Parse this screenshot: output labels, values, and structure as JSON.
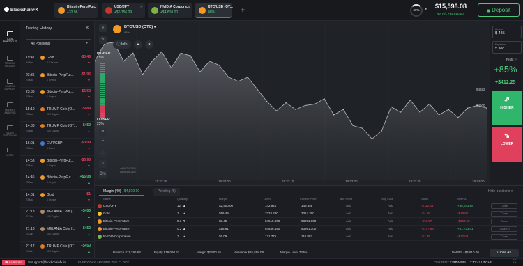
{
  "app": {
    "logo": "BlockchainFX"
  },
  "tabs": [
    {
      "name": "Bitcoin-Perp/Fu...",
      "pct": "+32.98",
      "color": "#f29a26"
    },
    {
      "name": "USD/JPY",
      "pct": "+$6,156.29",
      "color": "#c0392b"
    },
    {
      "name": "NVIDIA Corpora...",
      "pct": "+$4,810.00",
      "color": "#7cb342"
    },
    {
      "name": "BTC/USD (OT...",
      "pct": "88%",
      "color": "#f29a26"
    }
  ],
  "account": {
    "circle": "60%",
    "balance": "$15,598.08",
    "net_pl": "Net P/L +$4,610.00",
    "deposit_label": "Deposit"
  },
  "sidebar": [
    {
      "label": "TOTAL PORTFOLIO"
    },
    {
      "label": "TRADING HISTORY"
    },
    {
      "label": "CHATS & SUPPORT"
    },
    {
      "label": "MARKET ANALYSIS"
    },
    {
      "label": "VIDEO TUTORIALS"
    },
    {
      "label": "MORE"
    }
  ],
  "history": {
    "title": "Trading History",
    "close": "✕",
    "filter": "All Positions",
    "rows": [
      {
        "time": "19:41",
        "date": "24 Mar",
        "name": "Gold",
        "amount": "0.1 Ounce",
        "value": "-$0.46",
        "dir": "▼",
        "neg": true,
        "color": "#f29a26"
      },
      {
        "time": "23:36",
        "date": "23 Mar",
        "name": "Bitcoin-PerpFut...",
        "amount": "1 Crypto",
        "value": "-$1.96",
        "dir": "▼",
        "neg": true,
        "color": "#f29a26"
      },
      {
        "time": "23:36",
        "date": "23 Mar",
        "name": "Bitcoin-PerpFut...",
        "amount": "1 Crypto",
        "value": "-$6.52",
        "dir": "▼",
        "neg": true,
        "color": "#f29a26"
      },
      {
        "time": "15:10",
        "date": "23 Mar",
        "name": "TRUMP Coin (O...",
        "amount": "100 Crypto",
        "value": "-$489",
        "dir": "▼",
        "neg": true,
        "color": "#e07b2a"
      },
      {
        "time": "14:38",
        "date": "23 Mar",
        "name": "TRUMP Coin (OT...",
        "amount": "100 Crypto",
        "value": "+$450",
        "dir": "▲",
        "neg": false,
        "color": "#e07b2a"
      },
      {
        "time": "16:01",
        "date": "23 Mar",
        "name": "EUR/GBP",
        "amount": "1 Forex",
        "value": "-$0.09",
        "dir": "▼",
        "neg": true,
        "color": "#3a7bd5"
      },
      {
        "time": "14:53",
        "date": "23 Mar",
        "name": "Bitcoin-PerpFut...",
        "amount": "1 Crypto",
        "value": "-$5.93",
        "dir": "▼",
        "neg": true,
        "color": "#f29a26"
      },
      {
        "time": "14:45",
        "date": "23 Mar",
        "name": "Bitcoin-PerpFut...",
        "amount": "1 Crypto",
        "value": "+$5.08",
        "dir": "▲",
        "neg": false,
        "color": "#f29a26"
      },
      {
        "time": "14:01",
        "date": "23 Mar",
        "name": "Gold",
        "amount": "1 Ounce",
        "value": "-$1",
        "dir": "▼",
        "neg": true,
        "color": "#f29a26"
      },
      {
        "time": "21:18",
        "date": "21 Jan",
        "name": "MELANIA Coin (...",
        "amount": "100 Crypto",
        "value": "+$450",
        "dir": "▲",
        "neg": false,
        "color": "#b08968"
      },
      {
        "time": "21:18",
        "date": "21 Jan",
        "name": "MELANIA Coin (...",
        "amount": "100 Crypto",
        "value": "+$450",
        "dir": "▲",
        "neg": false,
        "color": "#b08968"
      },
      {
        "time": "21:17",
        "date": "21 Jan",
        "name": "TRUMP Coin (OT...",
        "amount": "100 Crypto",
        "value": "+$450",
        "dir": "▲",
        "neg": false,
        "color": "#e07b2a"
      }
    ]
  },
  "chart": {
    "asset": "BTC/USD (OTC)",
    "asset_sub": "88%",
    "info": "Info",
    "higher": "HIGHER",
    "higher_pct": "75%",
    "lower": "LOWER",
    "lower_pct": "25%",
    "price_right": [
      "94682",
      "94600"
    ],
    "x_times": [
      "19:32:45",
      "19:33:00",
      "19:33:15",
      "19:33:30",
      "19:33:45",
      "19:34:00"
    ],
    "bottom_left": [
      "vol 94,718.2500",
      "vol 94,598.2500"
    ]
  },
  "chart_data": {
    "type": "area",
    "x": [
      "19:32:38",
      "19:32:40",
      "19:32:42",
      "19:32:44",
      "19:32:46",
      "19:32:48",
      "19:32:50",
      "19:32:52",
      "19:32:54",
      "19:32:56",
      "19:32:58",
      "19:33:00",
      "19:33:02",
      "19:33:04",
      "19:33:06",
      "19:33:08",
      "19:33:10",
      "19:33:12",
      "19:33:14",
      "19:33:16",
      "19:33:18",
      "19:33:20",
      "19:33:22",
      "19:33:24",
      "19:33:26",
      "19:33:28",
      "19:33:30",
      "19:33:32",
      "19:33:34",
      "19:33:36",
      "19:33:38",
      "19:33:40",
      "19:33:42",
      "19:33:44",
      "19:33:46",
      "19:33:48",
      "19:33:50",
      "19:33:52",
      "19:33:54",
      "19:33:56",
      "19:33:58",
      "19:34:00"
    ],
    "values": [
      94700,
      94713,
      94714,
      94700,
      94706,
      94690,
      94700,
      94707,
      94695,
      94706,
      94704,
      94692,
      94700,
      94697,
      94688,
      94685,
      94688,
      94679,
      94670,
      94663,
      94669,
      94664,
      94667,
      94668,
      94672,
      94660,
      94664,
      94652,
      94650,
      94642,
      94648,
      94666,
      94662,
      94671,
      94662,
      94668,
      94660,
      94664,
      94658,
      94665,
      94667,
      94665
    ],
    "ylim": [
      94620,
      94730
    ]
  },
  "right": {
    "amount_label": "Amount",
    "amount": "$ 485",
    "expiration_label": "Expiration",
    "expiration": "5 sec",
    "profit_label": "Profit",
    "profit_pct": "+85%",
    "profit_val": "+$412.25",
    "higher_btn": "HIGHER",
    "lower_btn": "LOWER"
  },
  "positions": {
    "tab_margin": "Margin (40)",
    "tab_margin_val": "+$4,810.00",
    "tab_pending": "Pending (5)",
    "hide": "Hide positions",
    "headers": [
      "Name",
      "Quantity",
      "Margin",
      "Open",
      "Current Price",
      "Take Profit",
      "Stop Loss",
      "Swap",
      "Net P/L"
    ],
    "rows": [
      {
        "name": "USD/JPY",
        "qty": "12",
        "dir": "▲",
        "margin": "$2,400.00",
        "open": "142.921",
        "cur": "149.658",
        "tp": "Add",
        "sl": "Add",
        "swap": "-$112.41",
        "pl": "+$6,043.88",
        "plneg": false,
        "close": "Close",
        "color": "#c0392b"
      },
      {
        "name": "Gold",
        "qty": "1",
        "dir": "▲",
        "margin": "$66.49",
        "open": "3324.280",
        "cur": "3314.300",
        "tp": "Add",
        "sl": "Add",
        "swap": "-$4.65",
        "pl": "-$19.82",
        "plneg": true,
        "close": "Close",
        "color": "#f2c12e"
      },
      {
        "name": "Bitcoin-PerpFuture",
        "qty": "0.1",
        "dir": "▼",
        "margin": "$8.45",
        "open": "84515.000",
        "cur": "93991.600",
        "tp": "Add",
        "sl": "Add",
        "swap": "-$19.57",
        "pl": "-$963.22",
        "plneg": true,
        "close": "Close",
        "color": "#f29a26"
      },
      {
        "name": "Bitcoin-PerpFuture",
        "qty": "0.2",
        "dir": "▲",
        "margin": "$16.91",
        "open": "84536.450",
        "cur": "93991.300",
        "tp": "Add",
        "sl": "Add",
        "swap": "-$147.68",
        "pl": "+$1,733.01",
        "plneg": false,
        "close": "Close (2)",
        "color": "#f29a26"
      },
      {
        "name": "NVIDIA Corporation",
        "qty": "1",
        "dir": "▲",
        "margin": "$6.09",
        "open": "121.775",
        "cur": "110.893",
        "tp": "Add",
        "sl": "Add",
        "swap": "-$1.35",
        "pl": "-$10.09",
        "plneg": true,
        "close": "Close",
        "color": "#7cb342"
      }
    ],
    "summary": {
      "balance": "Balance $11,286.63",
      "equity": "Equity $18,098.63",
      "margin": "Margin $2,500.55",
      "available": "Available $15,598.08",
      "level": "Margin Level 723%",
      "net": "Net P/L +$4,610.00",
      "close_all": "Close All"
    }
  },
  "footer": {
    "support": "SUPPORT",
    "email": "support@blockchainfx.io",
    "tagline": "EVERY DAY, AROUND THE CLOCK",
    "time_label": "CURRENT TIME:",
    "time": "27 APRIL, 17:43:47 UTC+3"
  }
}
